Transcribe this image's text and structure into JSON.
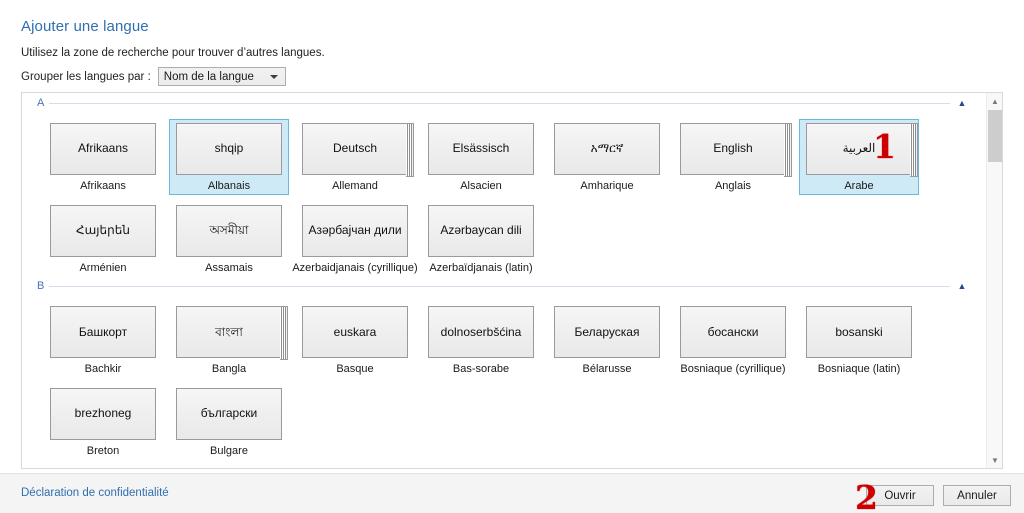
{
  "header": {
    "title": "Ajouter une langue",
    "subtitle": "Utilisez la zone de recherche pour trouver d’autres langues.",
    "group_label": "Grouper les langues par :",
    "group_value": "Nom de la langue",
    "group_caret_icon": "chevron-down-icon"
  },
  "sections": [
    {
      "letter": "A",
      "chevron_icon": "chevron-up-icon",
      "rows": [
        [
          {
            "native": "Afrikaans",
            "label": "Afrikaans",
            "stacked": false,
            "selected": false,
            "rtl": false
          },
          {
            "native": "shqip",
            "label": "Albanais",
            "stacked": false,
            "selected": true,
            "rtl": false
          },
          {
            "native": "Deutsch",
            "label": "Allemand",
            "stacked": true,
            "selected": false,
            "rtl": false
          },
          {
            "native": "Elsässisch",
            "label": "Alsacien",
            "stacked": false,
            "selected": false,
            "rtl": false
          },
          {
            "native": "አማርኛ",
            "label": "Amharique",
            "stacked": false,
            "selected": false,
            "rtl": false
          },
          {
            "native": "English",
            "label": "Anglais",
            "stacked": true,
            "selected": false,
            "rtl": false
          },
          {
            "native": "العربية",
            "label": "Arabe",
            "stacked": true,
            "selected": true,
            "rtl": true
          }
        ],
        [
          {
            "native": "Հայերեն",
            "label": "Arménien",
            "stacked": false,
            "selected": false,
            "rtl": false
          },
          {
            "native": "অসমীয়া",
            "label": "Assamais",
            "stacked": false,
            "selected": false,
            "rtl": false
          },
          {
            "native": "Азәрбајчан дили",
            "label": "Azerbaidjanais (cyrillique)",
            "stacked": false,
            "selected": false,
            "rtl": false
          },
          {
            "native": "Azərbaycan dili",
            "label": "Azerbaïdjanais (latin)",
            "stacked": false,
            "selected": false,
            "rtl": false
          }
        ]
      ]
    },
    {
      "letter": "B",
      "chevron_icon": "chevron-up-icon",
      "rows": [
        [
          {
            "native": "Башкорт",
            "label": "Bachkir",
            "stacked": false,
            "selected": false,
            "rtl": false
          },
          {
            "native": "বাংলা",
            "label": "Bangla",
            "stacked": true,
            "selected": false,
            "rtl": false
          },
          {
            "native": "euskara",
            "label": "Basque",
            "stacked": false,
            "selected": false,
            "rtl": false
          },
          {
            "native": "dolnoserbšćina",
            "label": "Bas-sorabe",
            "stacked": false,
            "selected": false,
            "rtl": false
          },
          {
            "native": "Беларуская",
            "label": "Bélarusse",
            "stacked": false,
            "selected": false,
            "rtl": false
          },
          {
            "native": "босански",
            "label": "Bosniaque (cyrillique)",
            "stacked": false,
            "selected": false,
            "rtl": false
          },
          {
            "native": "bosanski",
            "label": "Bosniaque (latin)",
            "stacked": false,
            "selected": false,
            "rtl": false
          }
        ],
        [
          {
            "native": "brezhoneg",
            "label": "Breton",
            "stacked": false,
            "selected": false,
            "rtl": false
          },
          {
            "native": "български",
            "label": "Bulgare",
            "stacked": false,
            "selected": false,
            "rtl": false
          }
        ]
      ]
    }
  ],
  "scrollbar": {
    "up_icon": "chevron-up-icon",
    "down_icon": "chevron-down-icon"
  },
  "footer": {
    "privacy_link": "Déclaration de confidentialité",
    "open_button": "Ouvrir",
    "cancel_button": "Annuler"
  },
  "annotations": [
    {
      "number": "1"
    },
    {
      "number": "2"
    }
  ],
  "colors": {
    "accent_link": "#2f6faf",
    "selection_fill": "#cfeaf7",
    "selection_border": "#6ab9e0",
    "annotation_red": "#cc0000",
    "section_letter": "#4a72b5"
  }
}
